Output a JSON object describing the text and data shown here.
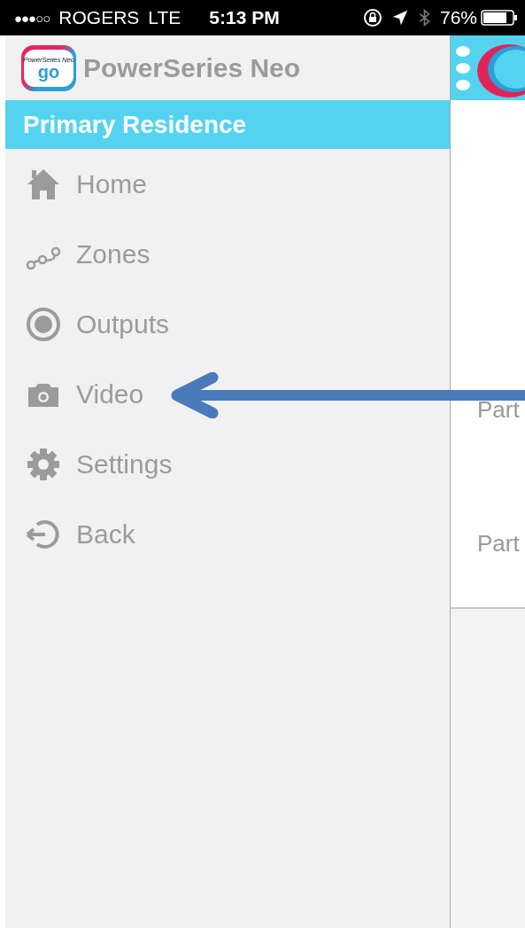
{
  "status_bar": {
    "signal_dots": "●●●○○",
    "carrier": "ROGERS",
    "network": "LTE",
    "time": "5:13 PM",
    "battery": "76%"
  },
  "sidebar": {
    "logo": {
      "caption": "PowerSeries Neo",
      "mark": "go"
    },
    "title": "PowerSeries Neo",
    "location": "Primary Residence",
    "items": [
      {
        "kind": "home",
        "label": "Home"
      },
      {
        "kind": "zones",
        "label": "Zones"
      },
      {
        "kind": "outputs",
        "label": "Outputs"
      },
      {
        "kind": "video",
        "label": "Video"
      },
      {
        "kind": "settings",
        "label": "Settings"
      },
      {
        "kind": "back",
        "label": "Back"
      }
    ]
  },
  "main_panel": {
    "rows": [
      "Part",
      "Part"
    ]
  },
  "annotation": {
    "kind": "arrow"
  }
}
